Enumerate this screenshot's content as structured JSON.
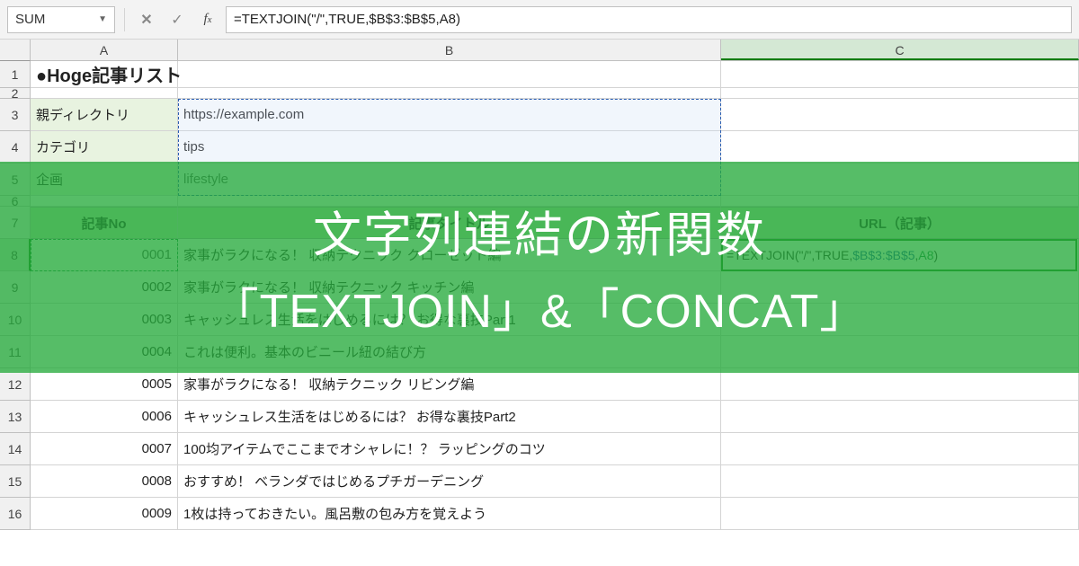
{
  "name_box": {
    "value": "SUM"
  },
  "formula_bar": {
    "formula": "=TEXTJOIN(\"/\",TRUE,$B$3:$B$5,A8)"
  },
  "columns": {
    "a": "A",
    "b": "B",
    "c": "C"
  },
  "rows": {
    "1": {
      "num": "1",
      "a": "●Hoge記事リスト"
    },
    "2": {
      "num": "2"
    },
    "3": {
      "num": "3",
      "a": "親ディレクトリ",
      "b": "https://example.com"
    },
    "4": {
      "num": "4",
      "a": "カテゴリ",
      "b": "tips"
    },
    "5": {
      "num": "5",
      "a": "企画",
      "b": "lifestyle"
    },
    "6": {
      "num": "6"
    },
    "7": {
      "num": "7",
      "a": "記事No",
      "b": "記事タイトル",
      "c": "URL（記事）"
    },
    "8": {
      "num": "8",
      "a": "0001",
      "b": "家事がラクになる！ 収納テクニック クローゼット編",
      "c_before": "=TEXTJOIN(\"/\",TRUE,",
      "c_ref1": "$B$3:$B$5",
      "c_mid": ",",
      "c_ref2": "A8",
      "c_after": ")"
    },
    "9": {
      "num": "9",
      "a": "0002",
      "b": "家事がラクになる！ 収納テクニック キッチン編"
    },
    "10": {
      "num": "10",
      "a": "0003",
      "b": "キャッシュレス生活をはじめるには？ お得な裏技Part1"
    },
    "11": {
      "num": "11",
      "a": "0004",
      "b": "これは便利。基本のビニール紐の結び方"
    },
    "12": {
      "num": "12",
      "a": "0005",
      "b": "家事がラクになる！ 収納テクニック リビング編"
    },
    "13": {
      "num": "13",
      "a": "0006",
      "b": "キャッシュレス生活をはじめるには？ お得な裏技Part2"
    },
    "14": {
      "num": "14",
      "a": "0007",
      "b": "100均アイテムでここまでオシャレに！？ ラッピングのコツ"
    },
    "15": {
      "num": "15",
      "a": "0008",
      "b": "おすすめ！ ベランダではじめるプチガーデニング"
    },
    "16": {
      "num": "16",
      "a": "0009",
      "b": "1枚は持っておきたい。風呂敷の包み方を覚えよう"
    }
  },
  "overlay": {
    "line1": "文字列連結の新関数",
    "line2_open": "「",
    "line2_fn1": "TEXTJOIN",
    "line2_mid": "」&「",
    "line2_fn2": "CONCAT",
    "line2_close": "」"
  }
}
